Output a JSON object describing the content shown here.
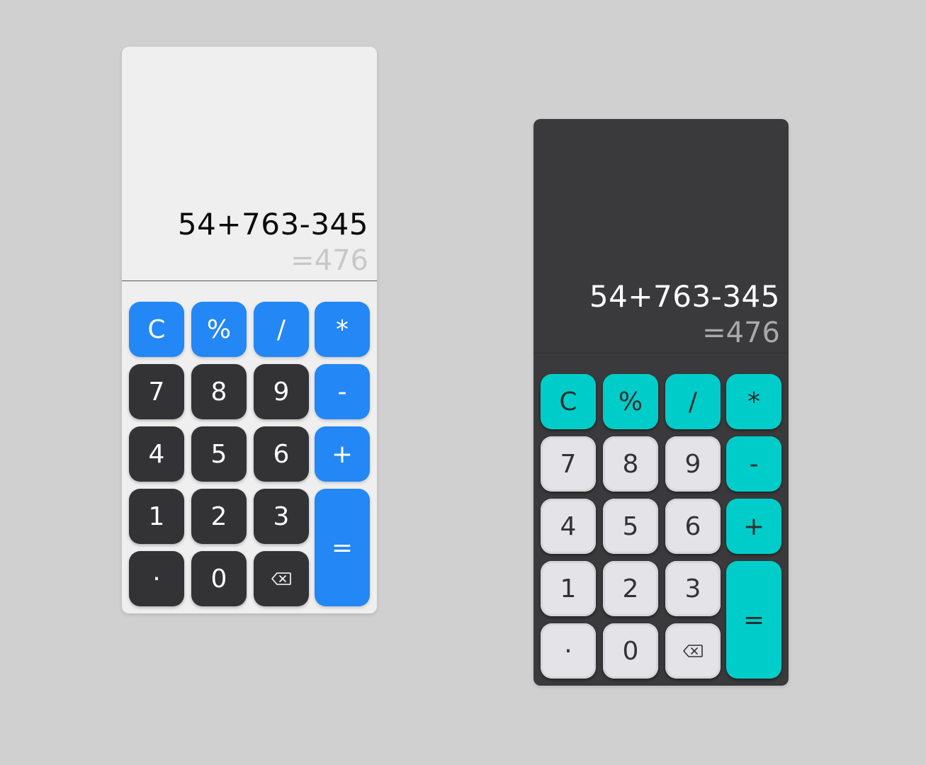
{
  "calculators": [
    {
      "theme": "light",
      "colors": {
        "panel": "#efefef",
        "operator_key": "#2387f5",
        "number_key": "#333335",
        "expression_text": "#0a0a0a",
        "result_text": "#c8c8c8"
      },
      "display": {
        "expression": "54+763-345",
        "result": "=476"
      },
      "keys": {
        "clear": "C",
        "percent": "%",
        "divide": "/",
        "multiply": "*",
        "seven": "7",
        "eight": "8",
        "nine": "9",
        "minus": "-",
        "four": "4",
        "five": "5",
        "six": "6",
        "plus": "+",
        "one": "1",
        "two": "2",
        "three": "3",
        "equals": "=",
        "decimal": "·",
        "zero": "0",
        "backspace_icon": "backspace-icon"
      }
    },
    {
      "theme": "dark",
      "colors": {
        "panel": "#3a3a3c",
        "operator_key": "#00cdc9",
        "number_key": "#e4e4e8",
        "expression_text": "#ffffff",
        "result_text": "#a9a9ab"
      },
      "display": {
        "expression": "54+763-345",
        "result": "=476"
      },
      "keys": {
        "clear": "C",
        "percent": "%",
        "divide": "/",
        "multiply": "*",
        "seven": "7",
        "eight": "8",
        "nine": "9",
        "minus": "-",
        "four": "4",
        "five": "5",
        "six": "6",
        "plus": "+",
        "one": "1",
        "two": "2",
        "three": "3",
        "equals": "=",
        "decimal": "·",
        "zero": "0",
        "backspace_icon": "backspace-icon"
      }
    }
  ]
}
